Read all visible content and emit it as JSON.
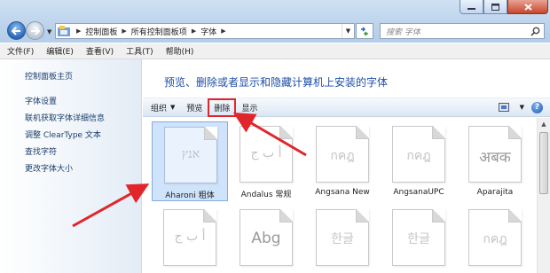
{
  "window": {
    "controls": [
      "minimize-icon",
      "maximize-icon",
      "close-icon"
    ]
  },
  "address_bar": {
    "breadcrumbs": [
      "控制面板",
      "所有控制面板项",
      "字体"
    ],
    "search_placeholder": "搜索 字体"
  },
  "menu": {
    "items": [
      "文件(F)",
      "编辑(E)",
      "查看(V)",
      "工具(T)",
      "帮助(H)"
    ]
  },
  "sidebar": {
    "home": "控制面板主页",
    "links": [
      "字体设置",
      "联机获取字体详细信息",
      "调整 ClearType 文本",
      "查找字符",
      "更改字体大小"
    ]
  },
  "main": {
    "title": "预览、删除或者显示和隐藏计算机上安装的字体"
  },
  "toolbar": {
    "organize": "组织",
    "preview": "预览",
    "delete": "删除",
    "show": "显示"
  },
  "fonts": [
    {
      "name": "Aharoni 粗体",
      "sample": "אנץ",
      "selected": true
    },
    {
      "name": "Andalus 常规",
      "sample": "أ ب ج"
    },
    {
      "name": "Angsana New",
      "sample": "กคฎ"
    },
    {
      "name": "AngsanaUPC",
      "sample": "กคฎ"
    },
    {
      "name": "Aparajita",
      "sample": "अबक"
    },
    {
      "name": "",
      "sample": "أ ب ج"
    },
    {
      "name": "",
      "sample": "Abg"
    },
    {
      "name": "",
      "sample": "한글"
    },
    {
      "name": "",
      "sample": "한글"
    },
    {
      "name": "",
      "sample": "กคฎ"
    }
  ],
  "colors": {
    "accent_title": "#1e4ea8",
    "annotation_red": "#e0262b",
    "selection": "#cfe3fb"
  }
}
